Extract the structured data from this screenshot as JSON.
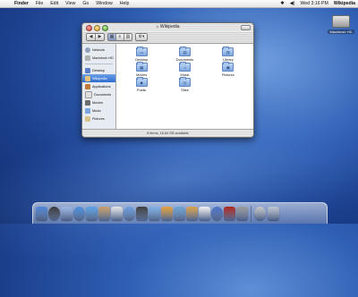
{
  "menubar": {
    "apple": "",
    "items": [
      "Finder",
      "File",
      "Edit",
      "View",
      "Go",
      "Window",
      "Help"
    ],
    "clock": "Wed 3:16 PM",
    "user": "Wikipedia"
  },
  "desktop": {
    "hd_label": "Macintosh HD"
  },
  "window": {
    "title": "Wikipedia",
    "toolbar": {
      "back": "◀",
      "forward": "▶",
      "action": "⚙▾"
    },
    "sidebar": {
      "devices": [
        {
          "label": "Network",
          "color": "#8fa2bb"
        },
        {
          "label": "Macintosh HD",
          "color": "#b0b0b0"
        }
      ],
      "places": [
        {
          "label": "Desktop",
          "color": "#5a7ec8"
        },
        {
          "label": "Wikipedia",
          "color": "#e8c27a"
        },
        {
          "label": "Applications",
          "color": "#c07a3a"
        },
        {
          "label": "Documents",
          "color": "#e0e0e0"
        },
        {
          "label": "Movies",
          "color": "#6b6b6b"
        },
        {
          "label": "Music",
          "color": "#7aa6e0"
        },
        {
          "label": "Pictures",
          "color": "#d7c28a"
        }
      ],
      "selected": "Wikipedia"
    },
    "files": [
      {
        "name": "Desktop",
        "glyph": "▭"
      },
      {
        "name": "Documents",
        "glyph": "▤"
      },
      {
        "name": "Library",
        "glyph": "▥"
      },
      {
        "name": "Movies",
        "glyph": "▦"
      },
      {
        "name": "Music",
        "glyph": "♫"
      },
      {
        "name": "Pictures",
        "glyph": "▣"
      },
      {
        "name": "Public",
        "glyph": "◆"
      },
      {
        "name": "Sites",
        "glyph": "◎"
      }
    ],
    "status": "8 items, 18.64 GB available"
  },
  "dock": {
    "apps": [
      {
        "name": "finder-icon",
        "color": "#4f86d9"
      },
      {
        "name": "dashboard-icon",
        "color": "#3a3a3a"
      },
      {
        "name": "mail-icon",
        "color": "#9bb7e6"
      },
      {
        "name": "safari-icon",
        "color": "#4a90e2"
      },
      {
        "name": "ichat-icon",
        "color": "#5aa2e8"
      },
      {
        "name": "address-book-icon",
        "color": "#c89f6a"
      },
      {
        "name": "ical-icon",
        "color": "#e6e6e6"
      },
      {
        "name": "itunes-icon",
        "color": "#6a9ee0"
      },
      {
        "name": "imovie-icon",
        "color": "#3f3f3f"
      },
      {
        "name": "iphoto-icon",
        "color": "#7fb0e8"
      },
      {
        "name": "garageband-icon",
        "color": "#e7a03a"
      },
      {
        "name": "idvd-icon",
        "color": "#6ea4d6"
      },
      {
        "name": "photo-booth-icon",
        "color": "#d9a24a"
      },
      {
        "name": "ical-date-icon",
        "color": "#f2f2f2"
      },
      {
        "name": "sync-icon",
        "color": "#4b73c9"
      },
      {
        "name": "dictionary-icon",
        "color": "#b0261d"
      },
      {
        "name": "preferences-icon",
        "color": "#9a9a9a"
      }
    ],
    "others": [
      {
        "name": "downloads-icon",
        "color": "#c8c8c8"
      },
      {
        "name": "trash-icon",
        "color": "#bfc7d1"
      }
    ]
  }
}
